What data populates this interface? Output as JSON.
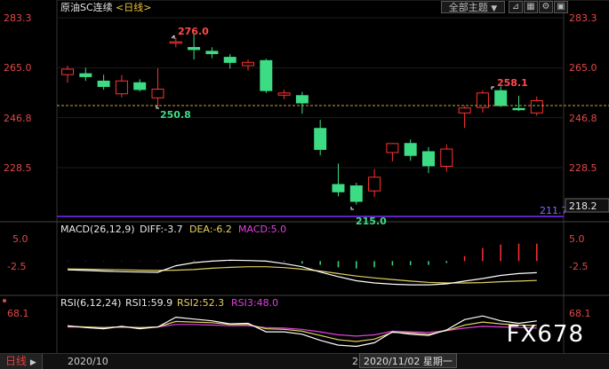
{
  "header": {
    "title": "原油SC连续",
    "period": "<日线>",
    "theme_button": "全部主题",
    "theme_dropdown_icon": "chevron-down-icon",
    "tool_icons": [
      "adjust-icon",
      "grid-icon",
      "settings-icon",
      "lock-icon"
    ]
  },
  "price_axis": {
    "ticks": [
      "283.3",
      "265.0",
      "246.8",
      "228.5"
    ],
    "tick_values": [
      283.3,
      265.0,
      246.8,
      228.5
    ],
    "low_tag": "211.7",
    "current_tag": "218.2"
  },
  "annotations": {
    "high": "276.0",
    "low1": "250.8",
    "low2": "215.0",
    "last_high": "258.1"
  },
  "macd": {
    "label": "MACD(26,12,9)",
    "diff": "DIFF:-3.7",
    "dea": "DEA:-6.2",
    "macd": "MACD:5.0",
    "ticks": [
      "5.0",
      "-2.5"
    ]
  },
  "rsi": {
    "label": "RSI(6,12,24)",
    "rsi1": "RSI1:59.9",
    "rsi2": "RSI2:52.3",
    "rsi3": "RSI3:48.0",
    "tick": "68.1"
  },
  "status": {
    "tab": "日线",
    "tab_icon": "play-icon",
    "date_left": "2020/10",
    "date_cursor": "2020/11/02 星期一",
    "date_cursor_prefix": "2"
  },
  "watermark": "FX678",
  "colors": {
    "up": "#ff3232",
    "down": "#3ddc84",
    "diff": "#ffffff",
    "dea": "#e0d060",
    "macd_label": "#e040e0",
    "low_line": "#7a2cff",
    "dash_line": "#c8a050"
  },
  "chart_data": {
    "type": "candlestick",
    "candles": [
      {
        "o": 262.5,
        "h": 265.8,
        "l": 259.5,
        "c": 264.5
      },
      {
        "o": 263.0,
        "h": 265.0,
        "l": 260.2,
        "c": 261.6
      },
      {
        "o": 260.3,
        "h": 262.5,
        "l": 257.0,
        "c": 258.0
      },
      {
        "o": 255.5,
        "h": 262.3,
        "l": 254.2,
        "c": 260.2
      },
      {
        "o": 259.7,
        "h": 260.8,
        "l": 256.3,
        "c": 256.9
      },
      {
        "o": 254.0,
        "h": 264.8,
        "l": 250.8,
        "c": 257.2
      },
      {
        "o": 274.3,
        "h": 276.0,
        "l": 272.5,
        "c": 274.5
      },
      {
        "o": 272.6,
        "h": 277.3,
        "l": 268.0,
        "c": 271.5
      },
      {
        "o": 271.2,
        "h": 272.5,
        "l": 268.5,
        "c": 270.0
      },
      {
        "o": 269.0,
        "h": 270.0,
        "l": 264.7,
        "c": 266.8
      },
      {
        "o": 265.8,
        "h": 268.0,
        "l": 264.0,
        "c": 267.0
      },
      {
        "o": 267.8,
        "h": 268.3,
        "l": 255.8,
        "c": 256.5
      },
      {
        "o": 255.0,
        "h": 257.0,
        "l": 253.5,
        "c": 255.8
      },
      {
        "o": 255.0,
        "h": 256.2,
        "l": 248.2,
        "c": 252.0
      },
      {
        "o": 243.0,
        "h": 246.0,
        "l": 233.0,
        "c": 235.0
      },
      {
        "o": 222.5,
        "h": 230.0,
        "l": 218.0,
        "c": 219.5
      },
      {
        "o": 222.0,
        "h": 223.0,
        "l": 215.0,
        "c": 216.0
      },
      {
        "o": 220.0,
        "h": 228.0,
        "l": 217.8,
        "c": 225.0
      },
      {
        "o": 234.0,
        "h": 237.5,
        "l": 230.8,
        "c": 237.3
      },
      {
        "o": 237.5,
        "h": 238.8,
        "l": 231.0,
        "c": 232.8
      },
      {
        "o": 234.5,
        "h": 236.0,
        "l": 226.5,
        "c": 229.0
      },
      {
        "o": 229.0,
        "h": 237.0,
        "l": 227.0,
        "c": 235.3
      },
      {
        "o": 248.5,
        "h": 251.0,
        "l": 243.0,
        "c": 250.3
      },
      {
        "o": 250.5,
        "h": 256.8,
        "l": 248.6,
        "c": 255.8
      },
      {
        "o": 256.8,
        "h": 258.1,
        "l": 250.7,
        "c": 251.0
      },
      {
        "o": 250.3,
        "h": 254.8,
        "l": 249.2,
        "c": 249.5
      },
      {
        "o": 248.5,
        "h": 254.5,
        "l": 247.5,
        "c": 253.0
      }
    ],
    "ylim": [
      211.7,
      283.3
    ],
    "macd_hist": [
      0.1,
      0.1,
      0.1,
      0.1,
      0.1,
      0.1,
      0.1,
      0.2,
      0.2,
      0.2,
      0.1,
      0.1,
      -0.2,
      -0.8,
      -1.2,
      -2.0,
      -2.4,
      -2.0,
      -1.4,
      -1.3,
      -1.2,
      -0.6,
      1.6,
      4.2,
      5.3,
      5.6,
      5.6
    ],
    "macd_diff": [
      -2.8,
      -3.0,
      -3.2,
      -3.4,
      -3.5,
      -3.6,
      -1.5,
      -0.5,
      0.0,
      0.3,
      0.2,
      0.0,
      -0.8,
      -1.8,
      -3.5,
      -5.0,
      -6.3,
      -7.0,
      -7.4,
      -7.6,
      -7.6,
      -7.3,
      -6.4,
      -5.6,
      -4.6,
      -4.0,
      -3.7
    ],
    "macd_dea": [
      -2.5,
      -2.6,
      -2.7,
      -2.8,
      -2.9,
      -3.0,
      -2.9,
      -2.7,
      -2.3,
      -2.0,
      -1.8,
      -1.8,
      -2.1,
      -2.6,
      -3.2,
      -4.0,
      -4.8,
      -5.4,
      -5.9,
      -6.4,
      -6.8,
      -7.0,
      -7.0,
      -6.9,
      -6.6,
      -6.4,
      -6.2
    ],
    "macd_ylim": [
      -9.0,
      7.5
    ],
    "rsi1": [
      52,
      49,
      47,
      51,
      47,
      50,
      66,
      63,
      60,
      55,
      56,
      42,
      42,
      38,
      28,
      20,
      18,
      24,
      42,
      38,
      36,
      45,
      62,
      68,
      60,
      56,
      59.9
    ],
    "rsi2": [
      51,
      50,
      49,
      50,
      49,
      50,
      59,
      58,
      57,
      54,
      54,
      47,
      46,
      43,
      36,
      29,
      26,
      30,
      41,
      40,
      38,
      44,
      53,
      58,
      55,
      53,
      52.3
    ],
    "rsi3": [
      50,
      50,
      49,
      50,
      49,
      50,
      54,
      54,
      53,
      52,
      52,
      49,
      48,
      46,
      42,
      37,
      35,
      37,
      43,
      42,
      41,
      44,
      48,
      51,
      50,
      49,
      48.0
    ],
    "rsi_ylim": [
      10,
      80
    ]
  }
}
